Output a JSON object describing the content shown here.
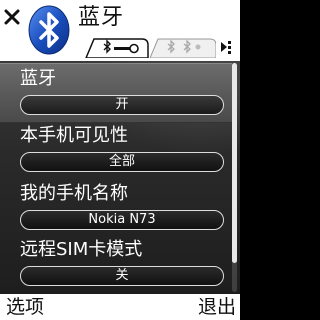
{
  "header": {
    "title": "蓝牙",
    "icons": {
      "close": "close-x-icon",
      "app": "bluetooth-icon",
      "tab_settings": "bluetooth-settings-tab-icon",
      "tab_devices": "bluetooth-devices-tab-icon",
      "scroll_indicator": "scroll-indicator-icon"
    }
  },
  "settings": [
    {
      "label": "蓝牙",
      "value": "开"
    },
    {
      "label": "本手机可见性",
      "value": "全部"
    },
    {
      "label": "我的手机名称",
      "value": "Nokia N73"
    },
    {
      "label": "远程SIM卡模式",
      "value": "关"
    }
  ],
  "softkeys": {
    "left": "选项",
    "right": "退出"
  },
  "colors": {
    "panel": "#2a2a2a",
    "selected": "#5a5a5a",
    "bluetooth_blue": "#1a4fbf",
    "text": "#ffffff"
  }
}
